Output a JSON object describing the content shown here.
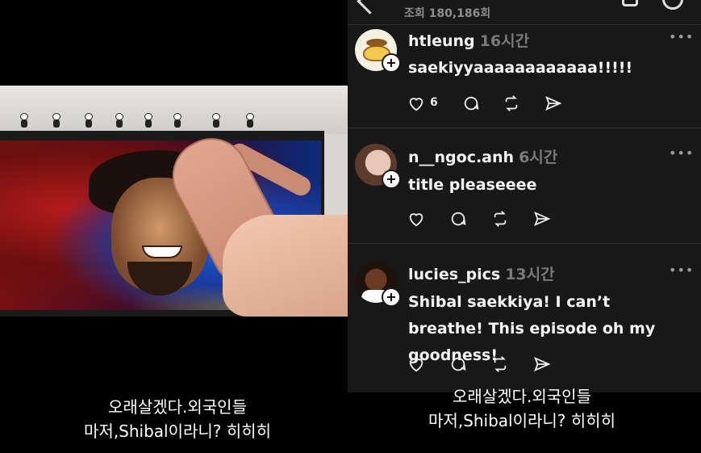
{
  "threads": {
    "views": "조회 180,186회",
    "comments": [
      {
        "username": "htleung",
        "time": "16시간",
        "text": "saekiyyaaaaaaaaaaaa!!!!!",
        "likes": "6"
      },
      {
        "username": "n__ngoc.anh",
        "time": "6시간",
        "text": "title pleaseeee",
        "likes": ""
      },
      {
        "username": "lucies_pics",
        "time": "13시간",
        "text": "Shibal saekkiya! I can’t breathe! This episode oh my goodness!",
        "likes": ""
      }
    ]
  },
  "captions": {
    "left_line1": "오래살겠다.외국인들",
    "left_line2": "마저,Shibal이라니? 히히히",
    "right_line1": "오래살겠다.외국인들",
    "right_line2": "마저,Shibal이라니? 히히히"
  },
  "icons": {
    "more": "more-icon",
    "like": "heart-icon",
    "reply": "comment-icon",
    "repost": "repost-icon",
    "share": "share-icon"
  }
}
